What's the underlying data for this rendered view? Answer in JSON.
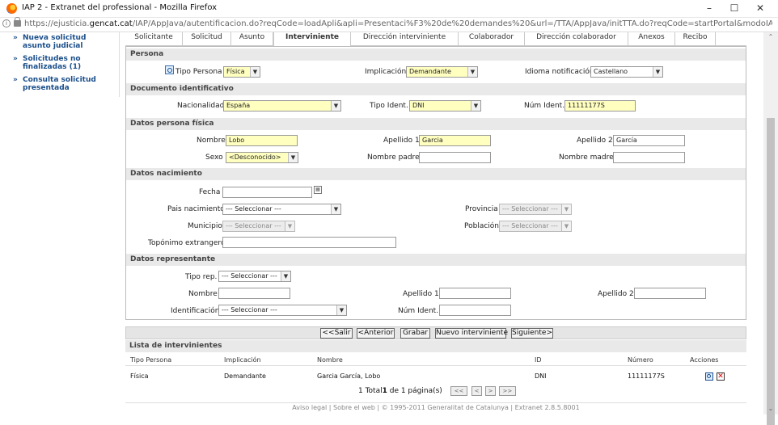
{
  "window": {
    "title": "IAP 2 - Extranet del professional - Mozilla Firefox",
    "url_prefix": "https://ejusticia.",
    "url_domain": "gencat.cat",
    "url_rest": "/IAP/AppJava/autentificacion.do?reqCode=loadApli&apli=Presentaci%F3%20de%20demandes%20&url=/TTA/AppJava/initTTA.do?reqCode=startPortal&modoIAP=S&set-locale=ca_ES&i"
  },
  "sidebar": {
    "items": [
      {
        "label": "Nueva solicitud asunto judicial"
      },
      {
        "label": "Solicitudes no finalizadas (1)"
      },
      {
        "label": "Consulta solicitud presentada"
      }
    ]
  },
  "tabs": [
    {
      "label": "Solicitante"
    },
    {
      "label": "Solicitud"
    },
    {
      "label": "Asunto"
    },
    {
      "label": "Interviniente"
    },
    {
      "label": "Dirección interviniente"
    },
    {
      "label": "Colaborador"
    },
    {
      "label": "Dirección colaborador"
    },
    {
      "label": "Anexos"
    },
    {
      "label": "Recibo"
    }
  ],
  "form": {
    "persona": {
      "section": "Persona",
      "tipo_persona_label": "Tipo Persona",
      "tipo_persona_value": "Física",
      "implicacion_label": "Implicación",
      "implicacion_value": "Demandante",
      "idioma_label": "Idioma notificación",
      "idioma_value": "Castellano"
    },
    "documento": {
      "section": "Documento identificativo",
      "nacionalidad_label": "Nacionalidad",
      "nacionalidad_value": "España",
      "tipo_ident_label": "Tipo Ident.",
      "tipo_ident_value": "DNI",
      "num_ident_label": "Núm Ident.",
      "num_ident_value": "11111177S"
    },
    "fisica": {
      "section": "Datos persona física",
      "nombre_label": "Nombre",
      "nombre_value": "Lobo",
      "apellido1_label": "Apellido 1",
      "apellido1_value": "Garcia",
      "apellido2_label": "Apellido 2",
      "apellido2_value": "García",
      "sexo_label": "Sexo",
      "sexo_value": "<Desconocido>",
      "nombre_padre_label": "Nombre padre",
      "nombre_padre_value": "",
      "nombre_madre_label": "Nombre madre",
      "nombre_madre_value": ""
    },
    "nacimiento": {
      "section": "Datos nacimiento",
      "fecha_label": "Fecha",
      "fecha_value": "",
      "pais_label": "Pais nacimiento",
      "pais_value": "--- Seleccionar ---",
      "provincia_label": "Provincia",
      "provincia_value": "--- Seleccionar ---",
      "municipio_label": "Municipio",
      "municipio_value": "--- Seleccionar ---",
      "poblacion_label": "Población",
      "poblacion_value": "--- Seleccionar ---",
      "toponimo_label": "Topónimo extrangero",
      "toponimo_value": ""
    },
    "representante": {
      "section": "Datos representante",
      "tipo_rep_label": "Tipo rep.",
      "tipo_rep_value": "--- Seleccionar ---",
      "nombre_label": "Nombre",
      "nombre_value": "",
      "apellido1_label": "Apellido 1",
      "apellido1_value": "",
      "apellido2_label": "Apellido 2",
      "apellido2_value": "",
      "identificacion_label": "Identificación",
      "identificacion_value": "--- Seleccionar ---",
      "num_ident_label": "Núm Ident.",
      "num_ident_value": ""
    }
  },
  "buttons": {
    "salir": "<<Salir",
    "anterior": "<Anterior",
    "grabar": "Grabar",
    "nuevo": "Nuevo interviniente",
    "siguiente": "Siguiente>"
  },
  "list": {
    "title": "Lista de intervinientes",
    "headers": [
      "Tipo Persona",
      "Implicación",
      "Nombre",
      "ID",
      "Número",
      "Acciones"
    ],
    "rows": [
      [
        "Física",
        "Demandante",
        "Garcia García, Lobo",
        "DNI",
        "11111177S"
      ]
    ],
    "pagination_total": "1 Total",
    "pagination_current": "1",
    "pagination_rest": " de 1 página(s)",
    "pager": [
      "<<",
      "<",
      ">",
      ">>"
    ]
  },
  "footer": {
    "links": [
      "Aviso legal",
      "Sobre el web",
      "© 1995-2011 Generalitat de Catalunya",
      "Extranet 2.8.5.8001"
    ],
    "separator": " | "
  },
  "colors": {
    "required_field": "#ffffc0",
    "section_bg": "#e9e9e9",
    "link_blue": "#1a4e8a"
  }
}
